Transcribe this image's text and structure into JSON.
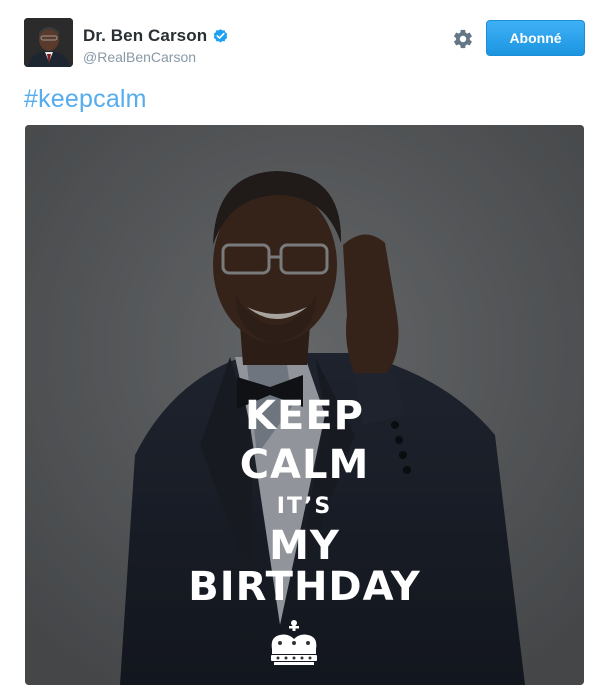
{
  "account": {
    "display_name": "Dr. Ben Carson",
    "handle": "@RealBenCarson",
    "verified_icon": "verified-badge-icon",
    "avatar_icon": "profile-avatar"
  },
  "actions": {
    "settings_icon": "gear-icon",
    "follow_label": "Abonné"
  },
  "tweet": {
    "text": "#keepcalm"
  },
  "media": {
    "lines": [
      "KEEP",
      "CALM",
      "IT’S",
      "MY",
      "BIRTHDAY"
    ],
    "crown_icon": "crown-icon"
  },
  "colors": {
    "accent": "#1da1f2",
    "hashtag": "#55acee",
    "name": "#292f33",
    "handle": "#8899a6"
  }
}
